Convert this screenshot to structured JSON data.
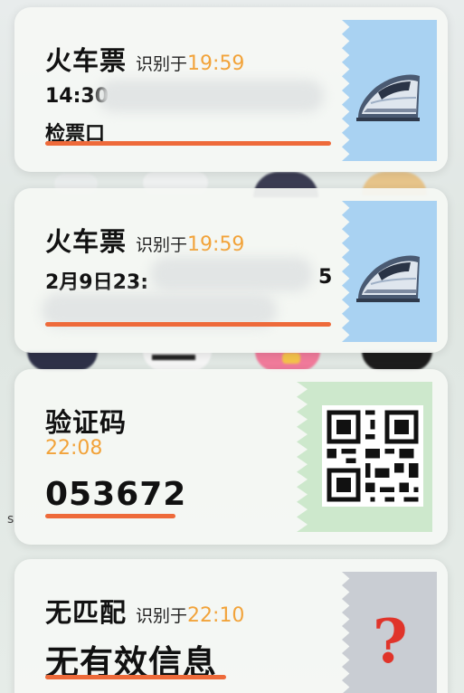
{
  "background": {
    "stray_text": "s"
  },
  "cards": [
    {
      "kind": "train_ticket",
      "title": "火车票",
      "recognized_label": "识别于",
      "recognized_time": "19:59",
      "line1": "14:30",
      "line2": "检票口",
      "icon": "train-icon"
    },
    {
      "kind": "train_ticket",
      "title": "火车票",
      "recognized_label": "识别于",
      "recognized_time": "19:59",
      "line1_left": "2月9日23:",
      "line1_right": "5",
      "icon": "train-icon"
    },
    {
      "kind": "verification_code",
      "title": "验证码",
      "time": "22:08",
      "code": "053672",
      "icon": "qr-code-icon"
    },
    {
      "kind": "no_match",
      "title": "无匹配",
      "recognized_label": "识别于",
      "recognized_time": "22:10",
      "message": "无有效信息",
      "icon": "question-mark-icon",
      "glyph": "?"
    }
  ],
  "colors": {
    "accent_underline": "#ee6a3a",
    "time_orange": "#f2a33a",
    "ticket_stub_blue": "#a9d2f2",
    "code_stub_green": "#cde8cc",
    "nomatch_stub_grey": "#c9cdd3",
    "question_red": "#e0342a"
  }
}
